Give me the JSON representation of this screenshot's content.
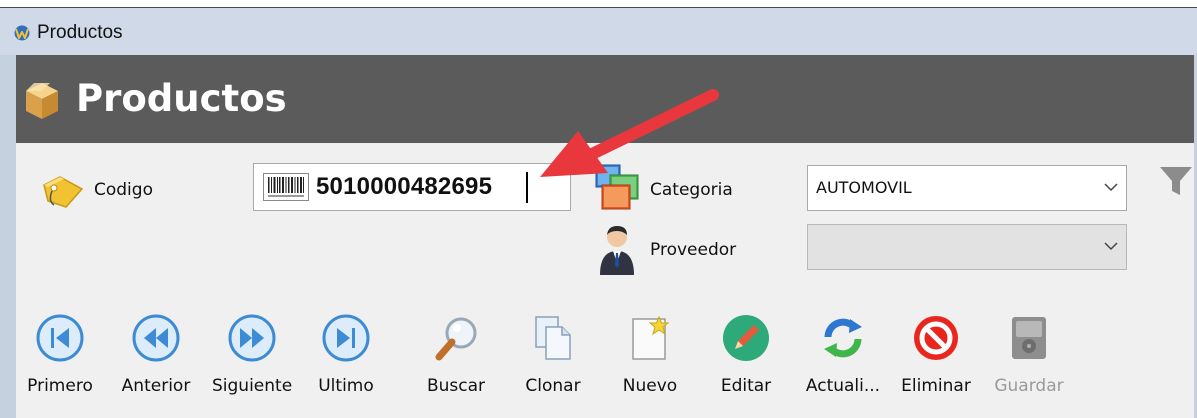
{
  "window": {
    "title": "Productos"
  },
  "header": {
    "title": "Productos"
  },
  "form": {
    "codigo": {
      "label": "Codigo",
      "value": "5010000482695"
    },
    "categoria": {
      "label": "Categoria",
      "selected": "AUTOMOVIL"
    },
    "proveedor": {
      "label": "Proveedor",
      "selected": ""
    }
  },
  "toolbar": {
    "primero": "Primero",
    "anterior": "Anterior",
    "siguiente": "Siguiente",
    "ultimo": "Ultimo",
    "buscar": "Buscar",
    "clonar": "Clonar",
    "nuevo": "Nuevo",
    "editar": "Editar",
    "actualizar": "Actuali...",
    "eliminar": "Eliminar",
    "guardar": "Guardar"
  },
  "colors": {
    "header_bg": "#5b5b5b",
    "titlebar_bg": "#cfd9e7",
    "content_bg": "#f0f0f0",
    "annotation_arrow": "#e8383d",
    "nav_button_blue": "#3d8bd4"
  },
  "icons": {
    "app": "app-logo-icon",
    "header": "box-icon",
    "codigo": "tag-icon",
    "barcode": "barcode-icon",
    "categoria": "categories-icon",
    "proveedor": "person-icon",
    "filter": "filter-icon"
  }
}
